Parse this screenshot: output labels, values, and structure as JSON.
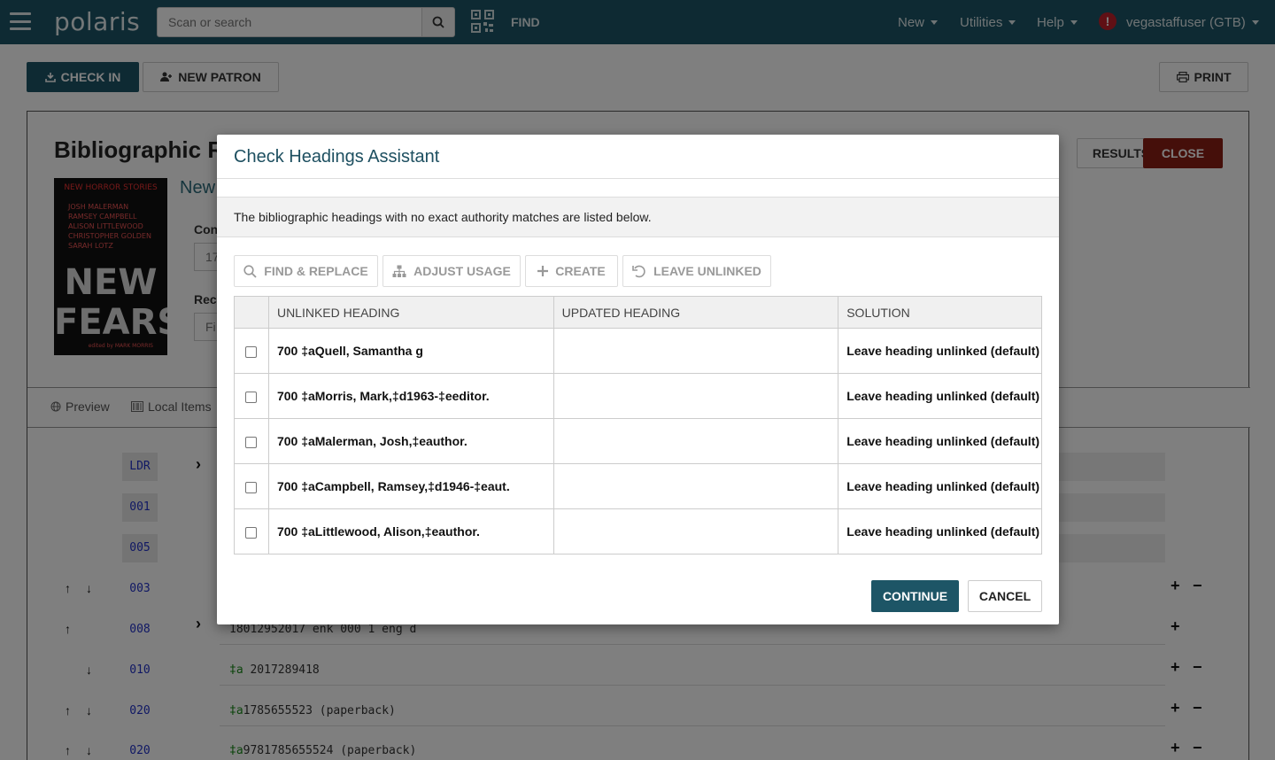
{
  "navbar": {
    "logo": "polaris",
    "search_placeholder": "Scan or search",
    "find_label": "FIND",
    "menus": [
      {
        "label": "New"
      },
      {
        "label": "Utilities"
      },
      {
        "label": "Help"
      }
    ],
    "user": "vegastaffuser (GTB)",
    "alert_glyph": "!",
    "bar_color": "#1d5566"
  },
  "toolbar": {
    "check_in": "CHECK IN",
    "new_patron": "NEW PATRON",
    "print": "PRINT"
  },
  "record": {
    "title_visible": "Bibliographic R",
    "subtitle_visible": "New",
    "results": "RESULTS",
    "close": "CLOSE",
    "label_con": "Con",
    "label_rec": "Rec",
    "input_value_1": "17",
    "input_value_2": "Fi",
    "tabs": [
      {
        "label": "Preview"
      },
      {
        "label": "Local Items"
      }
    ],
    "cover": {
      "top_line": "NEW HORROR STORIES",
      "authors": [
        "JOSH MALERMAN",
        "RAMSEY CAMPBELL",
        "ALISON LITTLEWOOD",
        "CHRISTOPHER GOLDEN",
        "SARAH LOTZ"
      ],
      "title_1": "NEW",
      "title_2": "FEARS",
      "editor": "edited by MARK MORRIS"
    },
    "marc_tags": [
      "LDR",
      "001",
      "005",
      "003",
      "008",
      "010",
      "020",
      "020"
    ],
    "marc_fields": {
      "f008": "18012952017    enk           000 1 eng d",
      "f010_sf": "‡a",
      "f010": " 2017289418",
      "f020a_sf": "‡a",
      "f020a": "1785655523 (paperback)",
      "f020b_sf": "‡a",
      "f020b": "9781785655524 (paperback)"
    }
  },
  "modal": {
    "title": "Check Headings Assistant",
    "info": "The bibliographic headings with no exact authority matches are listed below.",
    "toolbar": {
      "find_replace": "FIND & REPLACE",
      "adjust_usage": "ADJUST USAGE",
      "create": "CREATE",
      "leave_unlinked": "LEAVE UNLINKED"
    },
    "columns": {
      "unlinked": "UNLINKED HEADING",
      "updated": "UPDATED HEADING",
      "solution": "SOLUTION"
    },
    "rows": [
      {
        "unlinked": "700 ‡aQuell, Samantha g",
        "updated": "",
        "solution": "Leave heading unlinked (default)"
      },
      {
        "unlinked": "700 ‡aMorris, Mark,‡d1963-‡eeditor.",
        "updated": "",
        "solution": "Leave heading unlinked (default)"
      },
      {
        "unlinked": "700 ‡aMalerman, Josh,‡eauthor.",
        "updated": "",
        "solution": "Leave heading unlinked (default)"
      },
      {
        "unlinked": "700 ‡aCampbell, Ramsey,‡d1946-‡eaut.",
        "updated": "",
        "solution": "Leave heading unlinked (default)"
      },
      {
        "unlinked": "700 ‡aLittlewood, Alison,‡eauthor.",
        "updated": "",
        "solution": "Leave heading unlinked (default)"
      }
    ],
    "continue": "CONTINUE",
    "cancel": "CANCEL"
  }
}
